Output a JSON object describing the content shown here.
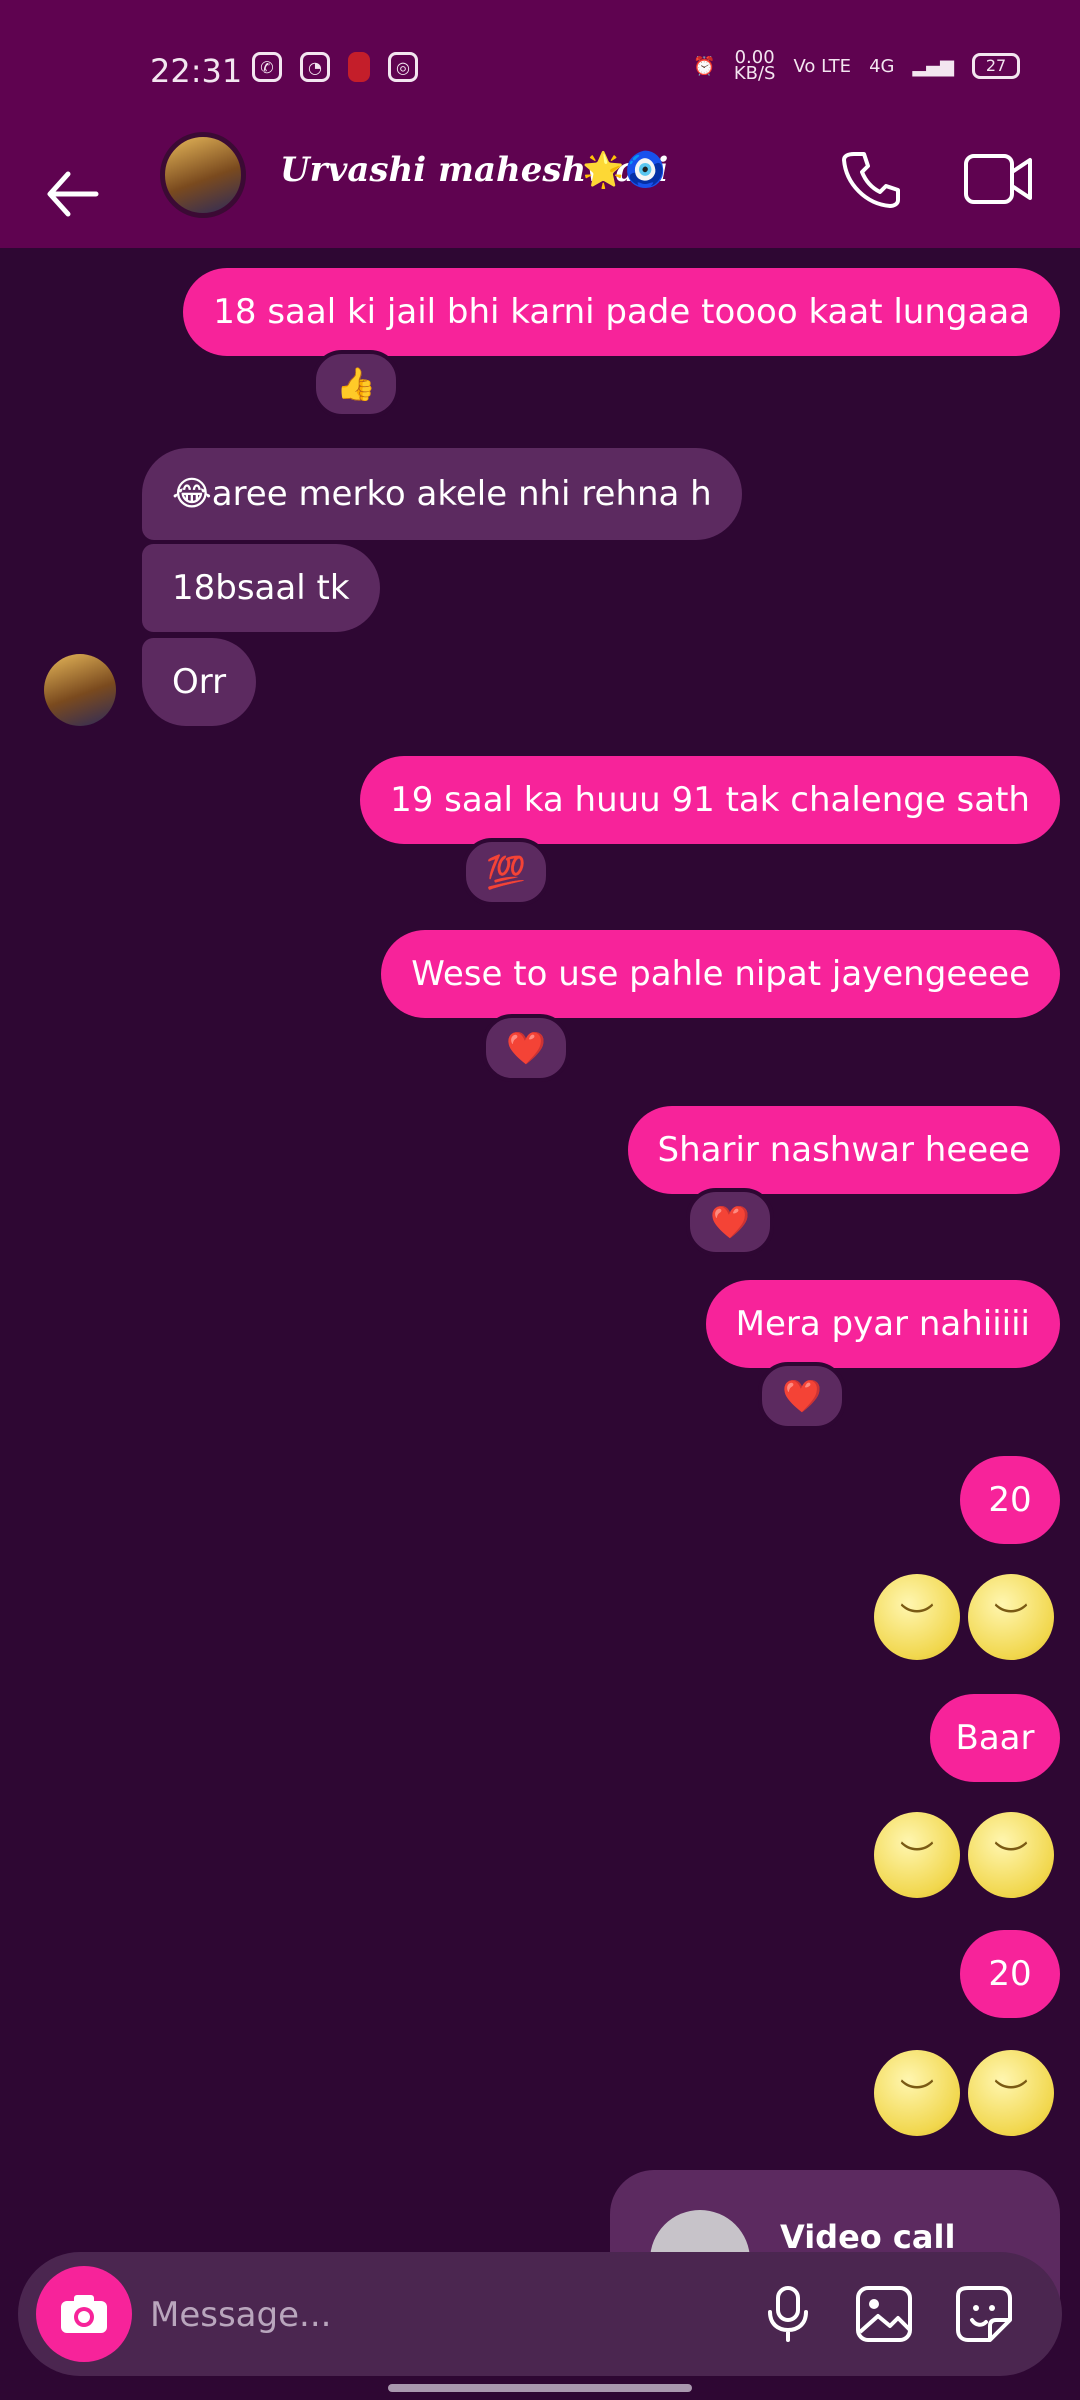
{
  "status_bar": {
    "time": "22:31",
    "net_speed": "0.00",
    "net_unit": "KB/S",
    "volte": "Vo LTE",
    "signal": "4G",
    "battery": "27"
  },
  "header": {
    "contact_name": "Urvashi maheshwari",
    "name_emoji": "🌟🧿",
    "accent_color": "#5f0350"
  },
  "messages": [
    {
      "id": "m1",
      "type": "sent",
      "text": "18 saal ki jail bhi karni pade toooo kaat lungaaa",
      "reaction": "👍"
    },
    {
      "id": "m2",
      "type": "received",
      "text": "😂aree merko akele nhi rehna h"
    },
    {
      "id": "m3",
      "type": "received",
      "text": "18bsaal tk"
    },
    {
      "id": "m4",
      "type": "received",
      "text": "Orr"
    },
    {
      "id": "m5",
      "type": "sent",
      "text": "19 saal ka huuu 91 tak chalenge sath",
      "reaction": "💯"
    },
    {
      "id": "m6",
      "type": "sent",
      "text": "Wese to use pahle nipat jayengeeee",
      "reaction": "❤️"
    },
    {
      "id": "m7",
      "type": "sent",
      "text": "Sharir nashwar heeee",
      "reaction": "❤️"
    },
    {
      "id": "m8",
      "type": "sent",
      "text": "Mera pyar nahiiiii",
      "reaction": "❤️"
    },
    {
      "id": "m9",
      "type": "sent",
      "text": "20"
    },
    {
      "id": "m10",
      "type": "sent_emoji",
      "text": "🌝🌝"
    },
    {
      "id": "m11",
      "type": "sent",
      "text": "Baar"
    },
    {
      "id": "m12",
      "type": "sent_emoji",
      "text": "🌝🌝"
    },
    {
      "id": "m13",
      "type": "sent",
      "text": "20"
    },
    {
      "id": "m14",
      "type": "sent_emoji",
      "text": "🌝🌝"
    }
  ],
  "call_event": {
    "text": "Video call ended"
  },
  "composer": {
    "placeholder": "Message...",
    "icons": [
      "camera-icon",
      "microphone-icon",
      "gallery-icon",
      "sticker-icon"
    ]
  },
  "colors": {
    "sent_bubble": "#f7239a",
    "received_bubble": "#5c2a60",
    "background": "#2e0733"
  }
}
